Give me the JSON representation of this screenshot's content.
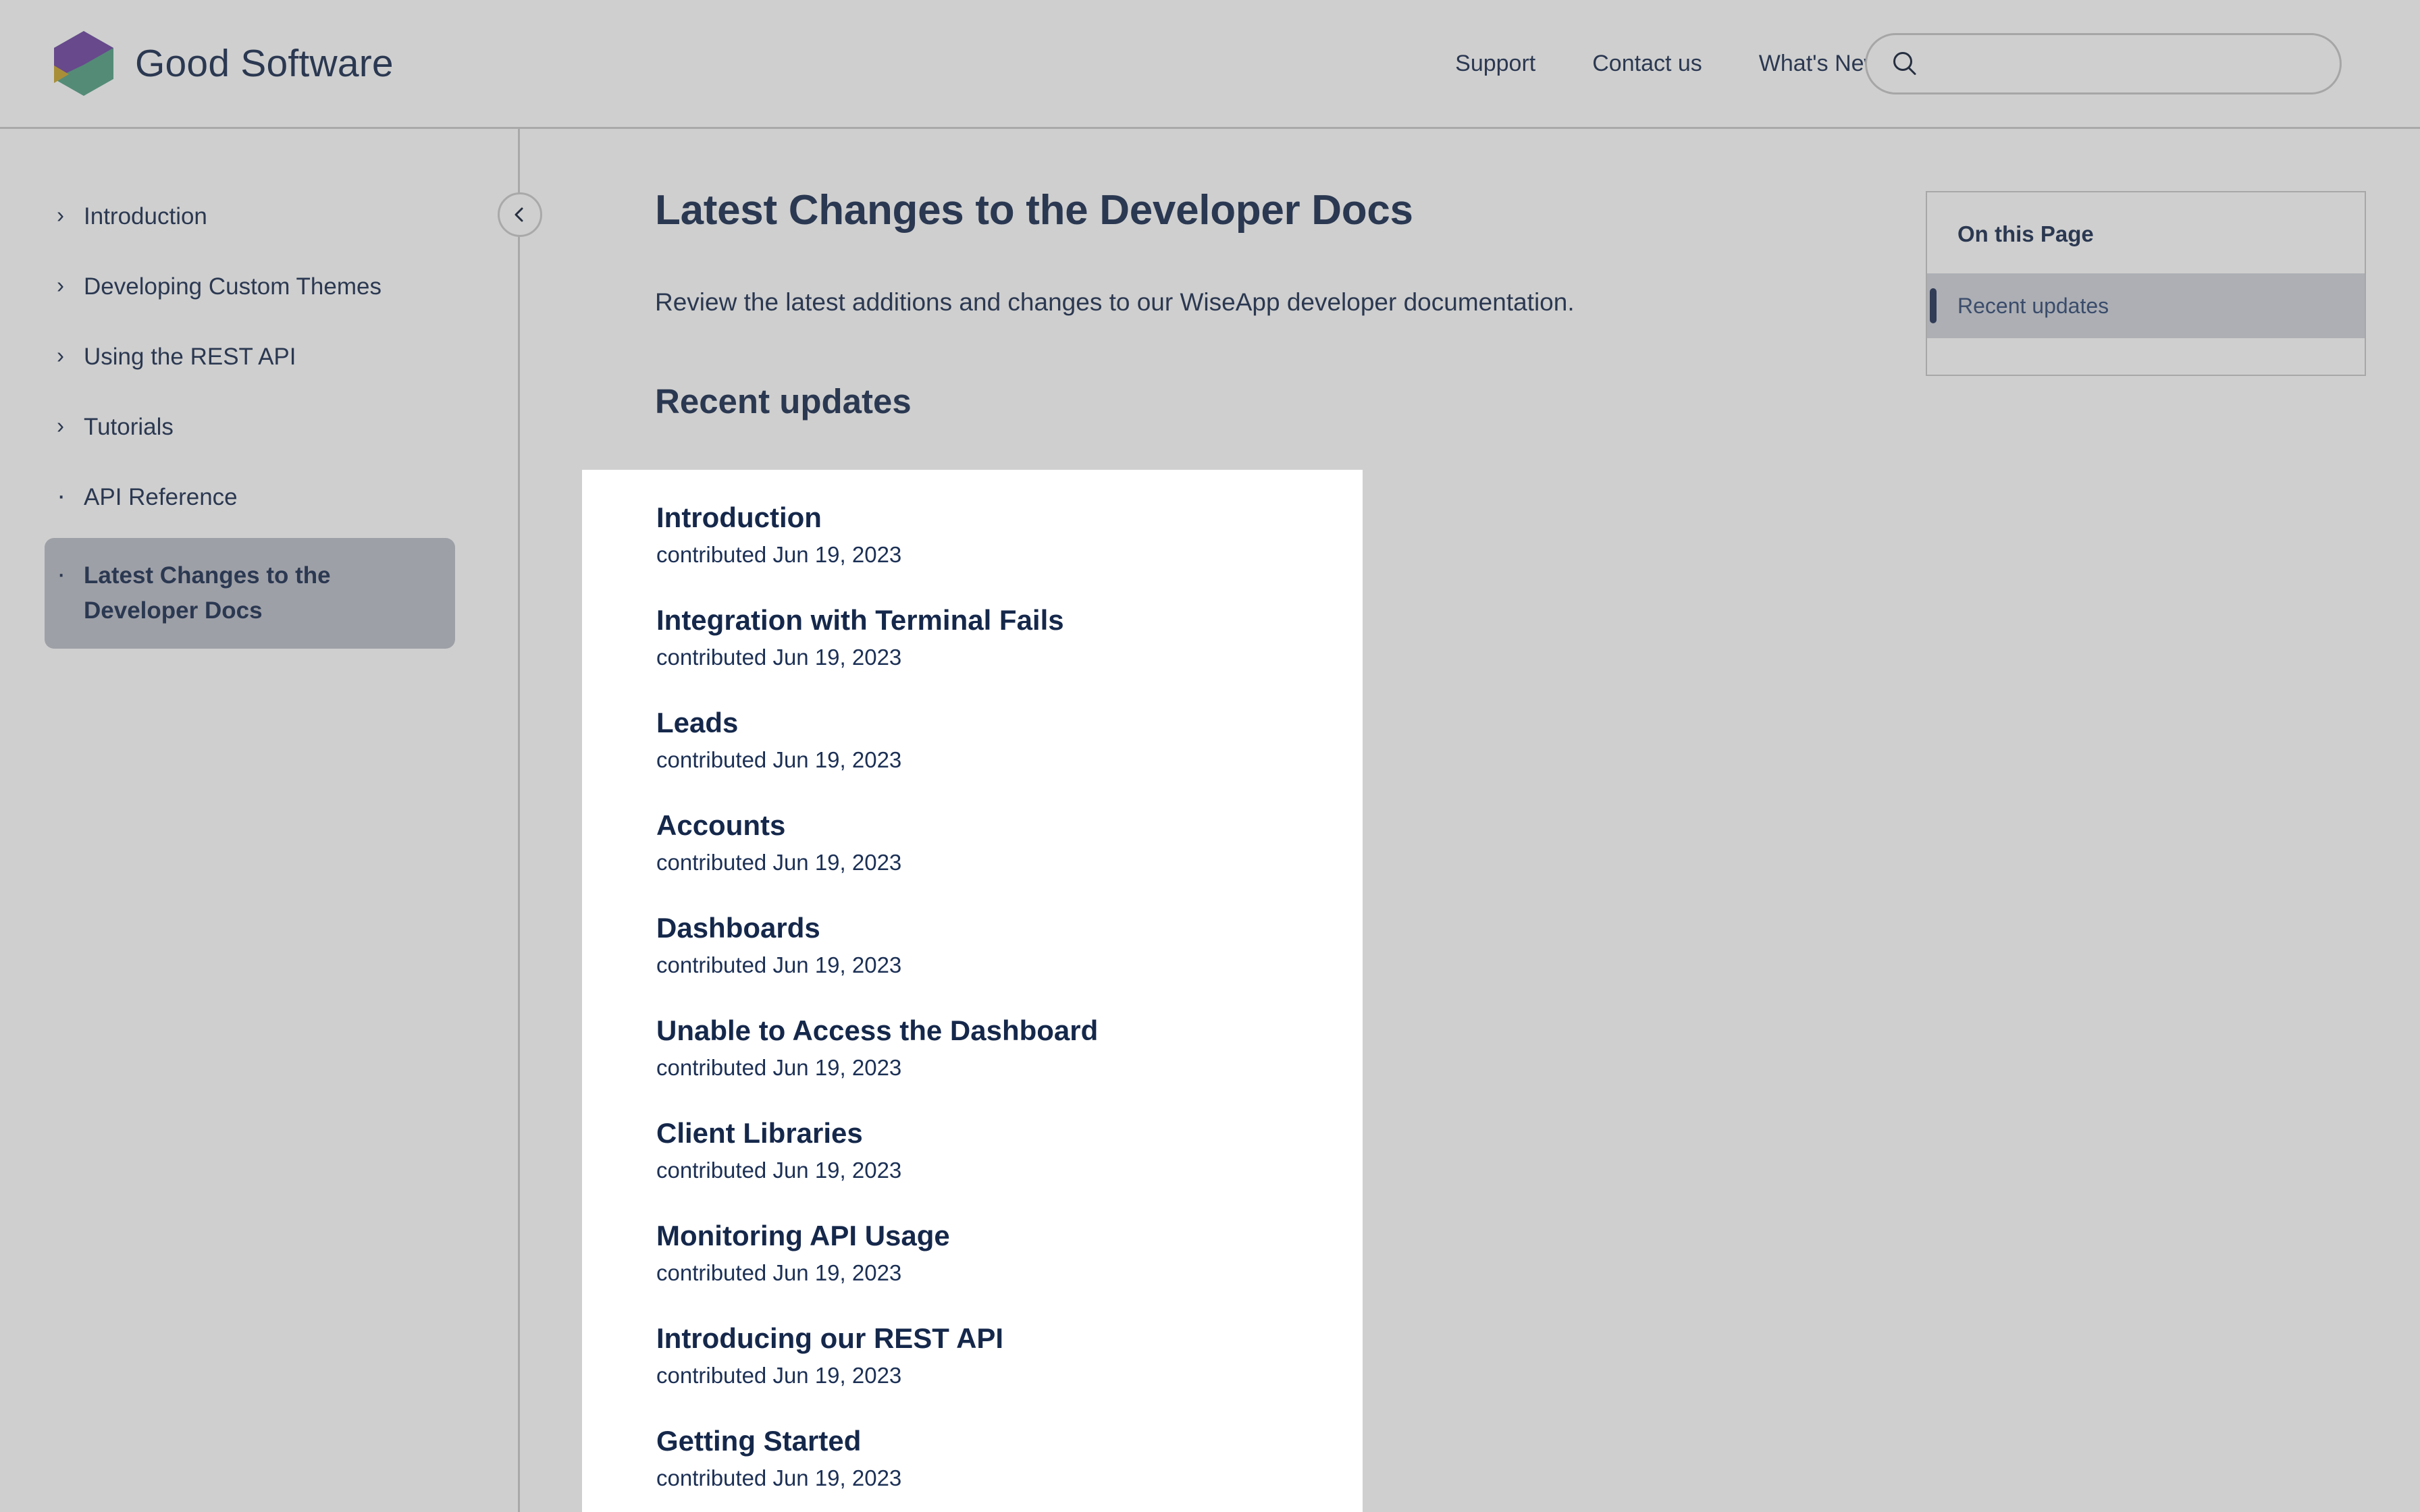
{
  "header": {
    "brand_name": "Good Software",
    "logo_icon": "hexagon-logo-icon",
    "colors": {
      "logo_purple": "#6b3fa0",
      "logo_green": "#4f9e82",
      "logo_gold": "#c9a227",
      "brand_text": "#15284b"
    },
    "nav": [
      {
        "label": "Support"
      },
      {
        "label": "Contact us"
      },
      {
        "label": "What's New?"
      }
    ],
    "search": {
      "icon": "search-icon",
      "value": "",
      "placeholder": ""
    }
  },
  "sidebar": {
    "collapse_button_icon": "chevron-left-icon",
    "items": [
      {
        "label": "Introduction",
        "marker": "chevron-right-icon",
        "marker_glyph": "›",
        "active": false
      },
      {
        "label": "Developing Custom Themes",
        "marker": "chevron-right-icon",
        "marker_glyph": "›",
        "active": false
      },
      {
        "label": "Using the REST API",
        "marker": "chevron-right-icon",
        "marker_glyph": "›",
        "active": false
      },
      {
        "label": "Tutorials",
        "marker": "chevron-right-icon",
        "marker_glyph": "›",
        "active": false
      },
      {
        "label": "API Reference",
        "marker": "bullet-icon",
        "marker_glyph": "·",
        "active": false
      },
      {
        "label": "Latest Changes to the Developer Docs",
        "marker": "bullet-icon",
        "marker_glyph": "·",
        "active": true
      }
    ]
  },
  "main": {
    "title": "Latest Changes to the Developer Docs",
    "subtitle": "Review the latest additions and changes to our WiseApp developer documentation.",
    "section_title": "Recent updates"
  },
  "on_this_page": {
    "title": "On this Page",
    "items": [
      {
        "label": "Recent updates",
        "active": true
      }
    ],
    "indicator_color": "#1d2d52"
  },
  "updates": {
    "meta_prefix": "contributed",
    "entries": [
      {
        "title": "Introduction",
        "meta": "contributed Jun 19, 2023"
      },
      {
        "title": "Integration with Terminal Fails",
        "meta": "contributed Jun 19, 2023"
      },
      {
        "title": "Leads",
        "meta": "contributed Jun 19, 2023"
      },
      {
        "title": "Accounts",
        "meta": "contributed Jun 19, 2023"
      },
      {
        "title": "Dashboards",
        "meta": "contributed Jun 19, 2023"
      },
      {
        "title": "Unable to Access the Dashboard",
        "meta": "contributed Jun 19, 2023"
      },
      {
        "title": "Client Libraries",
        "meta": "contributed Jun 19, 2023"
      },
      {
        "title": "Monitoring API Usage",
        "meta": "contributed Jun 19, 2023"
      },
      {
        "title": "Introducing our REST API",
        "meta": "contributed Jun 19, 2023"
      },
      {
        "title": "Getting Started",
        "meta": "contributed Jun 19, 2023"
      }
    ]
  }
}
